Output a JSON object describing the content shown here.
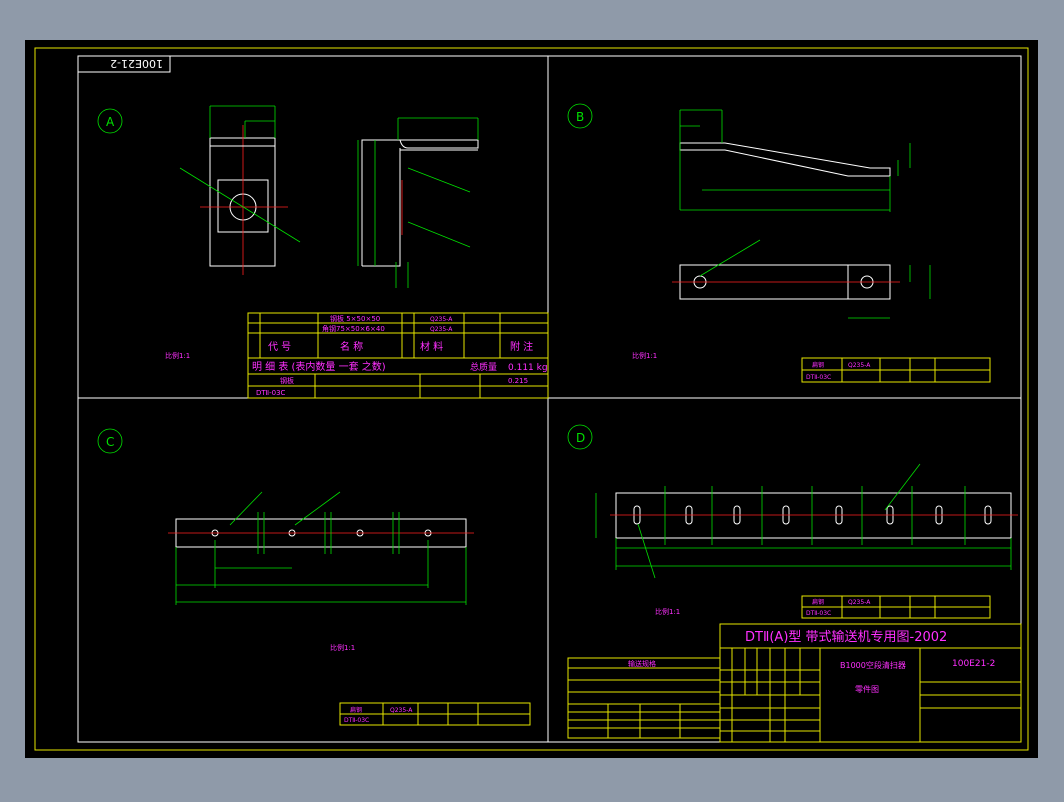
{
  "drawing": {
    "stamp": "100E21-2",
    "sheet_labels": [
      "A",
      "B",
      "C",
      "D"
    ],
    "title_block": {
      "main_title": "DTⅡ(A)型  带式输送机专用图-2002",
      "part_name": "B1000空段清扫器",
      "part_type": "零件图",
      "drawing_no": "100E21-2"
    }
  },
  "texts": {
    "notes_header": "输送规格",
    "table_a_row1": "钢板 5×50×50",
    "table_a_row2": "角钢75×50×6×40",
    "table_a_mat": "Q235-A",
    "table_a_header": [
      "代  号",
      "名    称",
      "材  料",
      "附  注"
    ],
    "table_a_caption": "明 细 表   (表内数量 一套 之数)",
    "table_a_weight": "0.111 kg",
    "table_a_weight_label": "总质量",
    "view_hint": "比例1:1",
    "row_plate": "钢板",
    "row_code": "DTⅡ-03C",
    "row_flat": "扁钢",
    "d_row": "Q235-A",
    "mass_small": "0.215"
  }
}
